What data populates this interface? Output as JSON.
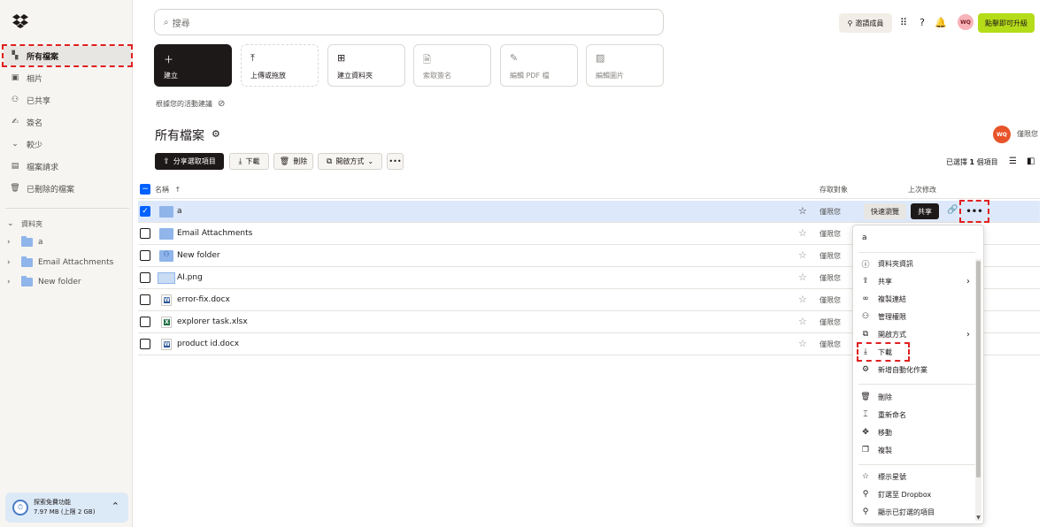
{
  "sidebar": {
    "nav": [
      {
        "label": "所有檔案",
        "icon": "files-icon"
      },
      {
        "label": "相片",
        "icon": "photo-icon"
      },
      {
        "label": "已共享",
        "icon": "shared-icon"
      },
      {
        "label": "簽名",
        "icon": "signature-icon"
      },
      {
        "label": "較少",
        "icon": "chevron-down-icon"
      },
      {
        "label": "檔案請求",
        "icon": "file-request-icon"
      },
      {
        "label": "已刪除的檔案",
        "icon": "trash-icon"
      }
    ],
    "folders_header": "資料夾",
    "folders": [
      {
        "label": "a"
      },
      {
        "label": "Email Attachments"
      },
      {
        "label": "New folder"
      }
    ],
    "upgrade_card": {
      "title": "探索免費功能",
      "storage": "7.97 MB (上限 2 GB)"
    }
  },
  "topbar": {
    "search_placeholder": "搜尋",
    "invite_label": "邀請成員",
    "avatar_initials": "WQ",
    "upgrade_label": "點擊即可升級"
  },
  "tiles": [
    {
      "label": "建立",
      "icon": "plus-icon"
    },
    {
      "label": "上傳或拖放",
      "icon": "upload-icon"
    },
    {
      "label": "建立資料夾",
      "icon": "new-folder-icon"
    },
    {
      "label": "索取簽名",
      "icon": "request-signature-icon"
    },
    {
      "label": "編輯 PDF 檔",
      "icon": "edit-pdf-icon"
    },
    {
      "label": "編輯圖片",
      "icon": "edit-image-icon"
    }
  ],
  "suggestion_text": "根據您的活動建議",
  "page_title": "所有檔案",
  "owner": {
    "initials": "WQ",
    "name": "僅限您"
  },
  "toolbar": {
    "share_label": "分享選取項目",
    "download_label": "下載",
    "delete_label": "刪除",
    "open_with_label": "開啟方式",
    "more_label": "•••",
    "selection_prefix": "已選擇",
    "selection_count": "1",
    "selection_suffix": "個項目"
  },
  "table": {
    "headers": {
      "name": "名稱",
      "access": "存取對象",
      "modified": "上次修改"
    },
    "rows": [
      {
        "name": "a",
        "type": "folder",
        "access": "僅限您",
        "selected": true
      },
      {
        "name": "Email Attachments",
        "type": "folder",
        "access": "僅限您",
        "selected": false
      },
      {
        "name": "New folder",
        "type": "shared-folder",
        "access": "僅限您",
        "selected": false
      },
      {
        "name": "AI.png",
        "type": "image",
        "access": "僅限您",
        "selected": false
      },
      {
        "name": "error-fix.docx",
        "type": "docx",
        "access": "僅限您",
        "selected": false
      },
      {
        "name": "explorer task.xlsx",
        "type": "xlsx",
        "access": "僅限您",
        "selected": false
      },
      {
        "name": "product id.docx",
        "type": "docx",
        "access": "僅限您",
        "selected": false
      }
    ],
    "row_actions": {
      "quick_view": "快速瀏覽",
      "share": "共享",
      "more": "•••"
    }
  },
  "context_menu": {
    "title": "a",
    "items": [
      {
        "label": "資料夾資訊",
        "icon": "info-icon"
      },
      {
        "label": "共享",
        "icon": "share-icon",
        "submenu": true
      },
      {
        "label": "複製連結",
        "icon": "link-icon"
      },
      {
        "label": "管理權限",
        "icon": "permissions-icon"
      },
      {
        "label": "開啟方式",
        "icon": "open-external-icon",
        "submenu": true
      },
      {
        "label": "下載",
        "icon": "download-icon"
      },
      {
        "label": "新增自動化作業",
        "icon": "automation-icon"
      },
      {
        "label": "刪除",
        "icon": "trash-icon"
      },
      {
        "label": "重新命名",
        "icon": "rename-icon"
      },
      {
        "label": "移動",
        "icon": "move-icon"
      },
      {
        "label": "複製",
        "icon": "copy-icon"
      },
      {
        "label": "標示星號",
        "icon": "star-icon"
      },
      {
        "label": "釘選至 Dropbox",
        "icon": "pin-icon"
      },
      {
        "label": "顯示已釘選的項目",
        "icon": "pinned-icon"
      }
    ]
  },
  "colors": {
    "accent_blue": "#0061fe",
    "upgrade_green": "#b4dc19",
    "highlight_red": "#e02020",
    "selected_row": "#dde9fb"
  }
}
